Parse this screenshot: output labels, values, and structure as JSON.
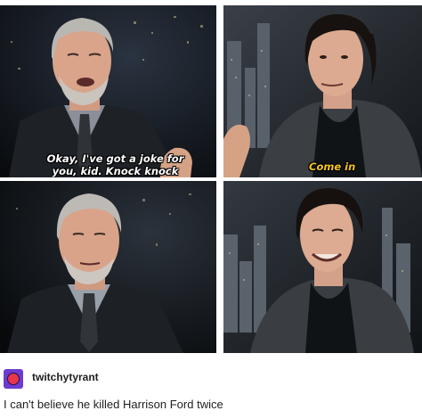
{
  "panels": [
    {
      "caption": "Okay, I've got a joke for you, kid. Knock knock"
    },
    {
      "caption": "Come in"
    },
    {
      "caption": ""
    },
    {
      "caption": ""
    }
  ],
  "post": {
    "username": "twitchytyrant",
    "text": "I can't believe he killed Harrison Ford twice"
  },
  "colors": {
    "caption_white": "#ffffff",
    "caption_yellow": "#f5c518",
    "avatar_bg": "#6c3cd0",
    "avatar_dot": "#e8364c"
  }
}
